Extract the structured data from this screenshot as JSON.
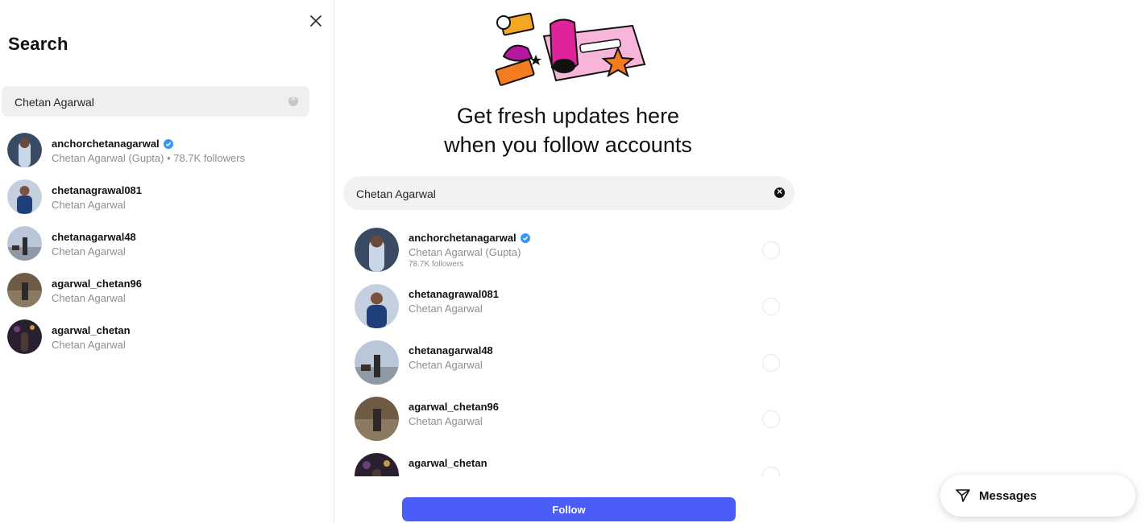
{
  "search_panel": {
    "title": "Search",
    "query": "Chetan Agarwal",
    "results": [
      {
        "username": "anchorchetanagarwal",
        "verified": true,
        "subtitle": "Chetan Agarwal (Gupta) • 78.7K followers"
      },
      {
        "username": "chetanagrawal081",
        "verified": false,
        "subtitle": "Chetan Agarwal"
      },
      {
        "username": "chetanagarwal48",
        "verified": false,
        "subtitle": "Chetan Agarwal"
      },
      {
        "username": "agarwal_chetan96",
        "verified": false,
        "subtitle": "Chetan Agarwal"
      },
      {
        "username": "agarwal_chetan",
        "verified": false,
        "subtitle": "Chetan Agarwal"
      }
    ]
  },
  "main": {
    "headline_line1": "Get fresh updates here",
    "headline_line2": "when you follow accounts",
    "query": "Chetan Agarwal",
    "suggestions": [
      {
        "username": "anchorchetanagarwal",
        "verified": true,
        "full_name": "Chetan Agarwal (Gupta)",
        "followers": "78.7K followers"
      },
      {
        "username": "chetanagrawal081",
        "verified": false,
        "full_name": "Chetan Agarwal",
        "followers": ""
      },
      {
        "username": "chetanagarwal48",
        "verified": false,
        "full_name": "Chetan Agarwal",
        "followers": ""
      },
      {
        "username": "agarwal_chetan96",
        "verified": false,
        "full_name": "Chetan Agarwal",
        "followers": ""
      },
      {
        "username": "agarwal_chetan",
        "verified": false,
        "full_name": "",
        "followers": ""
      }
    ],
    "follow_label": "Follow"
  },
  "messages": {
    "label": "Messages",
    "icon": "paper-plane-icon"
  },
  "colors": {
    "accent": "#4a5df9",
    "verified": "#3897f0",
    "muted": "#8e8e8e"
  }
}
